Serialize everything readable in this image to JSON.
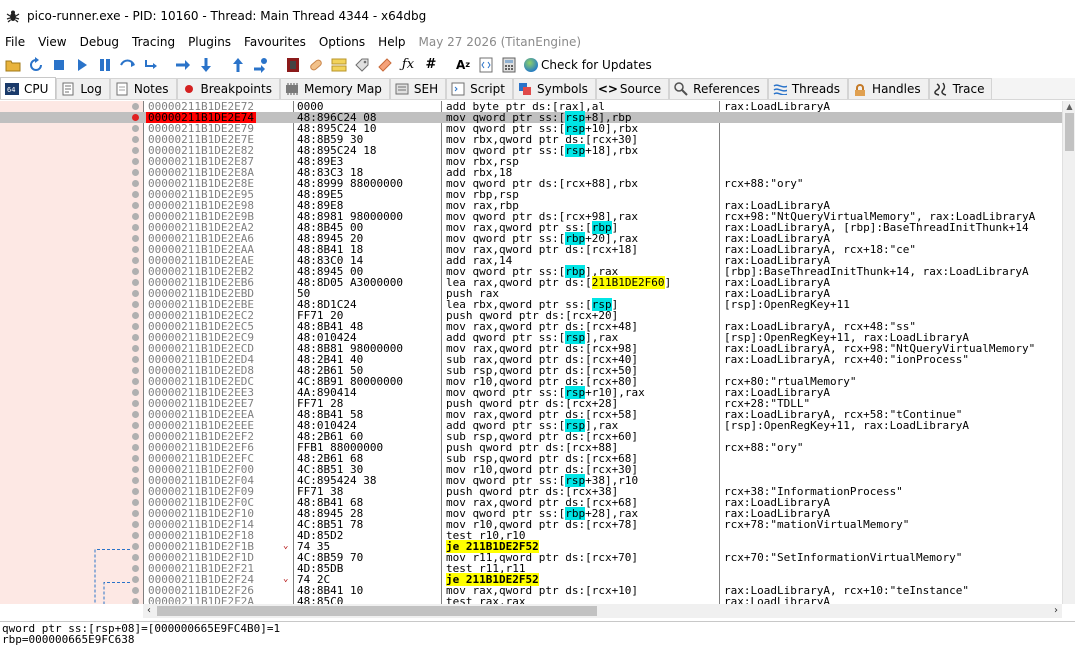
{
  "window": {
    "title": "pico-runner.exe - PID: 10160 - Thread: Main Thread 4344 - x64dbg"
  },
  "menu": [
    "File",
    "View",
    "Debug",
    "Tracing",
    "Plugins",
    "Favourites",
    "Options",
    "Help"
  ],
  "menu_date": "May 27 2026 (TitanEngine)",
  "toolbar": {
    "check_updates_label": "Check for Updates"
  },
  "tabs": [
    {
      "label": "CPU",
      "icon": "cpu-icon"
    },
    {
      "label": "Log",
      "icon": "log-icon"
    },
    {
      "label": "Notes",
      "icon": "notes-icon"
    },
    {
      "label": "Breakpoints",
      "icon": "breakpoints-icon"
    },
    {
      "label": "Memory Map",
      "icon": "memory-map-icon"
    },
    {
      "label": "SEH",
      "icon": "seh-icon"
    },
    {
      "label": "Script",
      "icon": "script-icon"
    },
    {
      "label": "Symbols",
      "icon": "symbols-icon"
    },
    {
      "label": "Source",
      "icon": "source-icon"
    },
    {
      "label": "References",
      "icon": "references-icon"
    },
    {
      "label": "Threads",
      "icon": "threads-icon"
    },
    {
      "label": "Handles",
      "icon": "handles-icon"
    },
    {
      "label": "Trace",
      "icon": "trace-icon"
    }
  ],
  "disasm_rows": [
    {
      "addr": "00000211B1DE2E72",
      "bytes": "0000",
      "instr": "add byte ptr ds:[rax],al",
      "comment": "rax:LoadLibraryA"
    },
    {
      "addr": "00000211B1DE2E74",
      "bytes": "48:896C24 08",
      "instr": "mov qword ptr ss:[rsp+8],rbp",
      "comment": "",
      "selected": true
    },
    {
      "addr": "00000211B1DE2E79",
      "bytes": "48:895C24 10",
      "instr": "mov qword ptr ss:[rsp+10],rbx",
      "comment": ""
    },
    {
      "addr": "00000211B1DE2E7E",
      "bytes": "48:8B59 30",
      "instr": "mov rbx,qword ptr ds:[rcx+30]",
      "comment": ""
    },
    {
      "addr": "00000211B1DE2E82",
      "bytes": "48:895C24 18",
      "instr": "mov qword ptr ss:[rsp+18],rbx",
      "comment": ""
    },
    {
      "addr": "00000211B1DE2E87",
      "bytes": "48:89E3",
      "instr": "mov rbx,rsp",
      "comment": ""
    },
    {
      "addr": "00000211B1DE2E8A",
      "bytes": "48:83C3 18",
      "instr": "add rbx,18",
      "comment": ""
    },
    {
      "addr": "00000211B1DE2E8E",
      "bytes": "48:8999 88000000",
      "instr": "mov qword ptr ds:[rcx+88],rbx",
      "comment": "rcx+88:\"ory\""
    },
    {
      "addr": "00000211B1DE2E95",
      "bytes": "48:89E5",
      "instr": "mov rbp,rsp",
      "comment": ""
    },
    {
      "addr": "00000211B1DE2E98",
      "bytes": "48:89E8",
      "instr": "mov rax,rbp",
      "comment": "rax:LoadLibraryA"
    },
    {
      "addr": "00000211B1DE2E9B",
      "bytes": "48:8981 98000000",
      "instr": "mov qword ptr ds:[rcx+98],rax",
      "comment": "rcx+98:\"NtQueryVirtualMemory\", rax:LoadLibraryA"
    },
    {
      "addr": "00000211B1DE2EA2",
      "bytes": "48:8B45 00",
      "instr": "mov rax,qword ptr ss:[rbp]",
      "comment": "rax:LoadLibraryA, [rbp]:BaseThreadInitThunk+14"
    },
    {
      "addr": "00000211B1DE2EA6",
      "bytes": "48:8945 20",
      "instr": "mov qword ptr ss:[rbp+20],rax",
      "comment": "rax:LoadLibraryA"
    },
    {
      "addr": "00000211B1DE2EAA",
      "bytes": "48:8B41 18",
      "instr": "mov rax,qword ptr ds:[rcx+18]",
      "comment": "rax:LoadLibraryA, rcx+18:\"ce\""
    },
    {
      "addr": "00000211B1DE2EAE",
      "bytes": "48:83C0 14",
      "instr": "add rax,14",
      "comment": "rax:LoadLibraryA"
    },
    {
      "addr": "00000211B1DE2EB2",
      "bytes": "48:8945 00",
      "instr": "mov qword ptr ss:[rbp],rax",
      "comment": "[rbp]:BaseThreadInitThunk+14, rax:LoadLibraryA"
    },
    {
      "addr": "00000211B1DE2EB6",
      "bytes": "48:8D05 A3000000",
      "instr": "lea rax,qword ptr ds:[211B1DE2F60]",
      "comment": "rax:LoadLibraryA"
    },
    {
      "addr": "00000211B1DE2EBD",
      "bytes": "50",
      "instr": "push rax",
      "comment": "rax:LoadLibraryA"
    },
    {
      "addr": "00000211B1DE2EBE",
      "bytes": "48:8D1C24",
      "instr": "lea rbx,qword ptr ss:[rsp]",
      "comment": "[rsp]:OpenRegKey+11"
    },
    {
      "addr": "00000211B1DE2EC2",
      "bytes": "FF71 20",
      "instr": "push qword ptr ds:[rcx+20]",
      "comment": ""
    },
    {
      "addr": "00000211B1DE2EC5",
      "bytes": "48:8B41 48",
      "instr": "mov rax,qword ptr ds:[rcx+48]",
      "comment": "rax:LoadLibraryA, rcx+48:\"ss\""
    },
    {
      "addr": "00000211B1DE2EC9",
      "bytes": "48:010424",
      "instr": "add qword ptr ss:[rsp],rax",
      "comment": "[rsp]:OpenRegKey+11, rax:LoadLibraryA"
    },
    {
      "addr": "00000211B1DE2ECD",
      "bytes": "48:8B81 98000000",
      "instr": "mov rax,qword ptr ds:[rcx+98]",
      "comment": "rax:LoadLibraryA, rcx+98:\"NtQueryVirtualMemory\""
    },
    {
      "addr": "00000211B1DE2ED4",
      "bytes": "48:2B41 40",
      "instr": "sub rax,qword ptr ds:[rcx+40]",
      "comment": "rax:LoadLibraryA, rcx+40:\"ionProcess\""
    },
    {
      "addr": "00000211B1DE2ED8",
      "bytes": "48:2B61 50",
      "instr": "sub rsp,qword ptr ds:[rcx+50]",
      "comment": ""
    },
    {
      "addr": "00000211B1DE2EDC",
      "bytes": "4C:8B91 80000000",
      "instr": "mov r10,qword ptr ds:[rcx+80]",
      "comment": "rcx+80:\"rtualMemory\""
    },
    {
      "addr": "00000211B1DE2EE3",
      "bytes": "4A:890414",
      "instr": "mov qword ptr ss:[rsp+r10],rax",
      "comment": "rax:LoadLibraryA"
    },
    {
      "addr": "00000211B1DE2EE7",
      "bytes": "FF71 28",
      "instr": "push qword ptr ds:[rcx+28]",
      "comment": "rcx+28:\"TDLL\""
    },
    {
      "addr": "00000211B1DE2EEA",
      "bytes": "48:8B41 58",
      "instr": "mov rax,qword ptr ds:[rcx+58]",
      "comment": "rax:LoadLibraryA, rcx+58:\"tContinue\""
    },
    {
      "addr": "00000211B1DE2EEE",
      "bytes": "48:010424",
      "instr": "add qword ptr ss:[rsp],rax",
      "comment": "[rsp]:OpenRegKey+11, rax:LoadLibraryA"
    },
    {
      "addr": "00000211B1DE2EF2",
      "bytes": "48:2B61 60",
      "instr": "sub rsp,qword ptr ds:[rcx+60]",
      "comment": ""
    },
    {
      "addr": "00000211B1DE2EF6",
      "bytes": "FFB1 88000000",
      "instr": "push qword ptr ds:[rcx+88]",
      "comment": "rcx+88:\"ory\""
    },
    {
      "addr": "00000211B1DE2EFC",
      "bytes": "48:2B61 68",
      "instr": "sub rsp,qword ptr ds:[rcx+68]",
      "comment": ""
    },
    {
      "addr": "00000211B1DE2F00",
      "bytes": "4C:8B51 30",
      "instr": "mov r10,qword ptr ds:[rcx+30]",
      "comment": ""
    },
    {
      "addr": "00000211B1DE2F04",
      "bytes": "4C:895424 38",
      "instr": "mov qword ptr ss:[rsp+38],r10",
      "comment": ""
    },
    {
      "addr": "00000211B1DE2F09",
      "bytes": "FF71 38",
      "instr": "push qword ptr ds:[rcx+38]",
      "comment": "rcx+38:\"InformationProcess\""
    },
    {
      "addr": "00000211B1DE2F0C",
      "bytes": "48:8B41 68",
      "instr": "mov rax,qword ptr ds:[rcx+68]",
      "comment": "rax:LoadLibraryA"
    },
    {
      "addr": "00000211B1DE2F10",
      "bytes": "48:8945 28",
      "instr": "mov qword ptr ss:[rbp+28],rax",
      "comment": "rax:LoadLibraryA"
    },
    {
      "addr": "00000211B1DE2F14",
      "bytes": "4C:8B51 78",
      "instr": "mov r10,qword ptr ds:[rcx+78]",
      "comment": "rcx+78:\"mationVirtualMemory\""
    },
    {
      "addr": "00000211B1DE2F18",
      "bytes": "4D:85D2",
      "instr": "test r10,r10",
      "comment": ""
    },
    {
      "addr": "00000211B1DE2F1B",
      "bytes": "74 35",
      "instr": "je 211B1DE2F52",
      "comment": "",
      "jump": true
    },
    {
      "addr": "00000211B1DE2F1D",
      "bytes": "4C:8B59 70",
      "instr": "mov r11,qword ptr ds:[rcx+70]",
      "comment": "rcx+70:\"SetInformationVirtualMemory\""
    },
    {
      "addr": "00000211B1DE2F21",
      "bytes": "4D:85DB",
      "instr": "test r11,r11",
      "comment": ""
    },
    {
      "addr": "00000211B1DE2F24",
      "bytes": "74 2C",
      "instr": "je 211B1DE2F52",
      "comment": "",
      "jump": true
    },
    {
      "addr": "00000211B1DE2F26",
      "bytes": "48:8B41 10",
      "instr": "mov rax,qword ptr ds:[rcx+10]",
      "comment": "rax:LoadLibraryA, rcx+10:\"teInstance\""
    },
    {
      "addr": "00000211B1DE2F2A",
      "bytes": "48:85C0",
      "instr": "test rax,rax",
      "comment": "rax:LoadLibraryA"
    }
  ],
  "info_panel": [
    "qword ptr ss:[rsp+08]=[000000665E9FC4B0]=1",
    "rbp=000000665E9FC638"
  ],
  "colors": {
    "gutter": "#fde8e4",
    "selected_row": "#c0c0c0",
    "selected_addr": "#ff0000",
    "reg_highlight": "#00e5e5",
    "jump_highlight": "#ffff00",
    "address_text": "#808080"
  }
}
